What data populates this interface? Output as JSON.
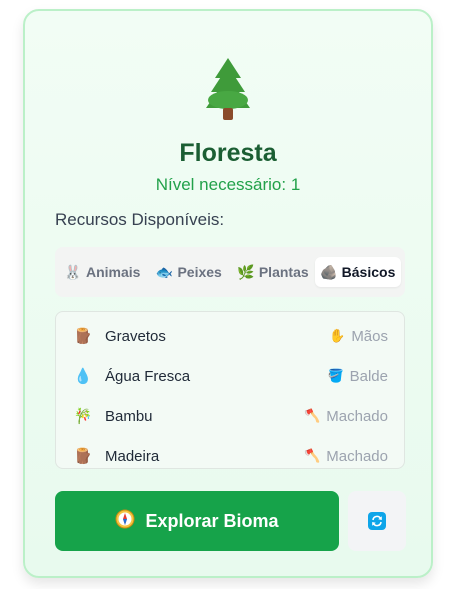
{
  "biome": {
    "icon": "evergreen-tree-icon",
    "name": "Floresta",
    "level_text": "Nível necessário: 1"
  },
  "resources": {
    "heading": "Recursos Disponíveis:",
    "tabs": [
      {
        "label": "Animais",
        "icon": "rabbit-icon",
        "active": false
      },
      {
        "label": "Peixes",
        "icon": "fish-icon",
        "active": false
      },
      {
        "label": "Plantas",
        "icon": "herb-icon",
        "active": false
      },
      {
        "label": "Básicos",
        "icon": "rock-icon",
        "active": true
      }
    ],
    "items": [
      {
        "name": "Gravetos",
        "icon": "wood-log-icon",
        "tool": "Mãos",
        "tool_icon": "hand-icon"
      },
      {
        "name": "Água Fresca",
        "icon": "water-drop-icon",
        "tool": "Balde",
        "tool_icon": "bucket-icon"
      },
      {
        "name": "Bambu",
        "icon": "bamboo-icon",
        "tool": "Machado",
        "tool_icon": "axe-icon"
      },
      {
        "name": "Madeira",
        "icon": "wood-log-icon",
        "tool": "Machado",
        "tool_icon": "axe-icon"
      }
    ]
  },
  "actions": {
    "explore_label": "Explorar Bioma",
    "explore_icon": "compass-icon",
    "refresh_icon": "refresh-icon"
  },
  "colors": {
    "accent": "#16a34a",
    "title": "#1b5e33",
    "level": "#22a14a"
  }
}
